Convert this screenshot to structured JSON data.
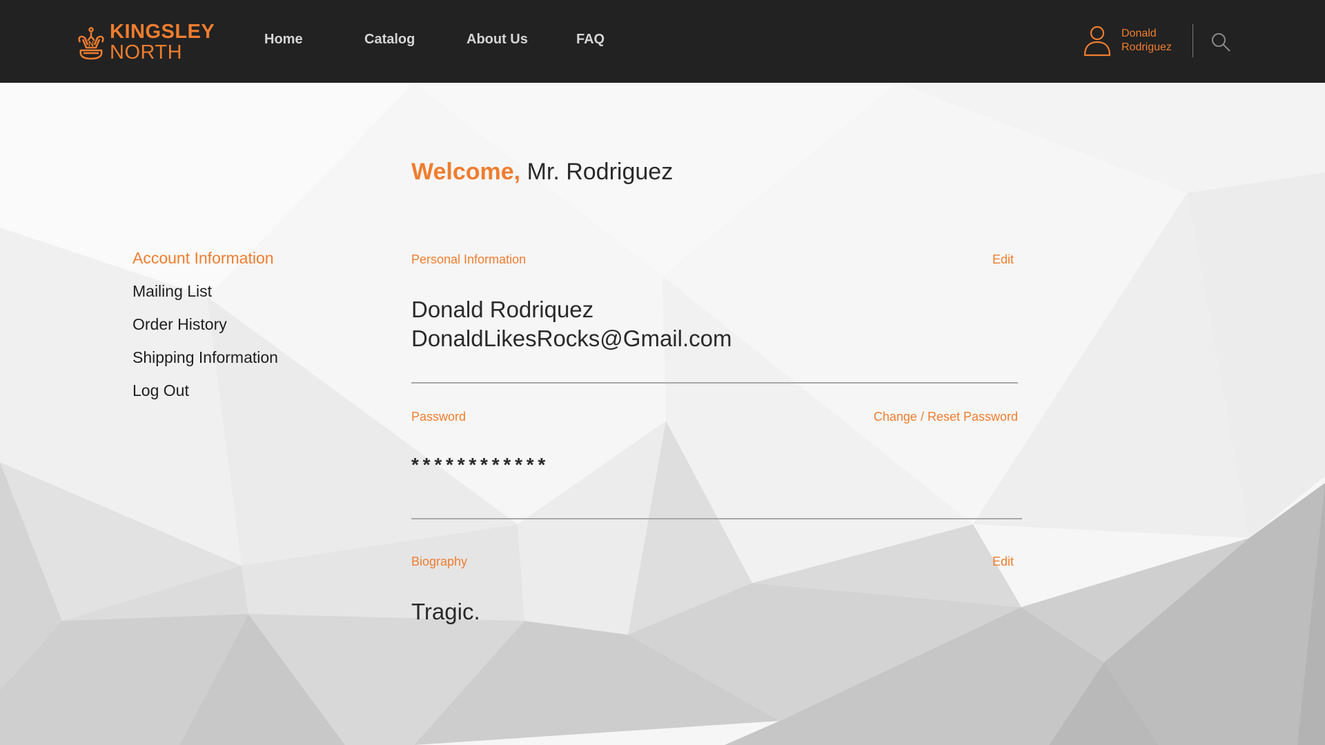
{
  "brand": {
    "name_line1": "KINGSLEY",
    "name_line2": "NORTH",
    "accent_color": "#ef7d2f"
  },
  "nav": {
    "items": [
      {
        "label": "Home"
      },
      {
        "label": "Catalog"
      },
      {
        "label": "About Us"
      },
      {
        "label": "FAQ"
      }
    ]
  },
  "user": {
    "first_name": "Donald",
    "last_name": "Rodriguez",
    "icon": "user-icon"
  },
  "search": {
    "icon": "search-icon"
  },
  "welcome": {
    "greeting": "Welcome,",
    "name": "Mr. Rodriguez"
  },
  "sidebar": {
    "items": [
      {
        "label": "Account Information",
        "active": true
      },
      {
        "label": "Mailing List",
        "active": false
      },
      {
        "label": "Order History",
        "active": false
      },
      {
        "label": "Shipping Information",
        "active": false
      },
      {
        "label": "Log Out",
        "active": false
      }
    ]
  },
  "personal": {
    "label": "Personal Information",
    "action": "Edit",
    "full_name": "Donald Rodriquez",
    "email": "DonaldLikesRocks@Gmail.com"
  },
  "password": {
    "label": "Password",
    "action": "Change / Reset Password",
    "masked": "* * * * * * * * * * * *"
  },
  "biography": {
    "label": "Biography",
    "action": "Edit",
    "text": "Tragic."
  }
}
